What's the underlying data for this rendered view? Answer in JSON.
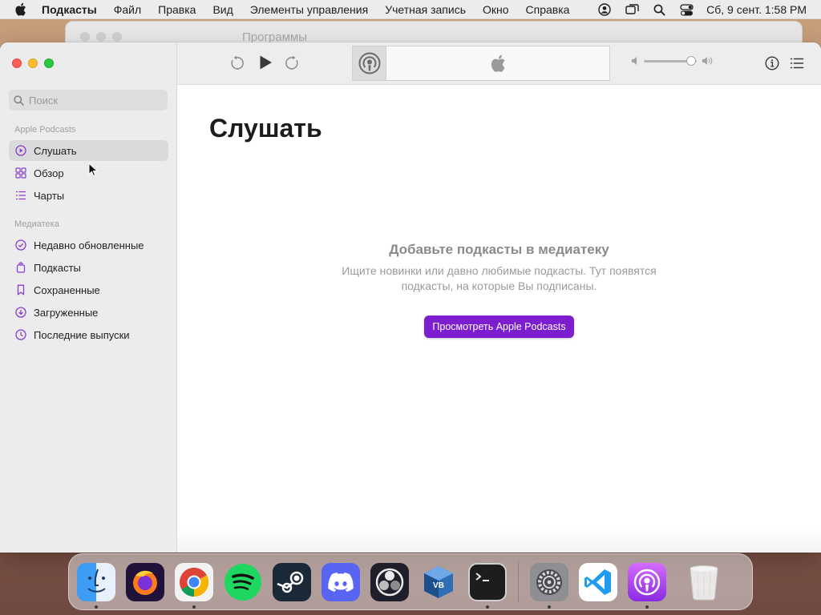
{
  "menubar": {
    "items": [
      "Подкасты",
      "Файл",
      "Правка",
      "Вид",
      "Элементы управления",
      "Учетная запись",
      "Окно",
      "Справка"
    ],
    "clock": "Сб, 9 сент.  1:58 PM"
  },
  "background_window": {
    "title": "Программы"
  },
  "sidebar": {
    "search_placeholder": "Поиск",
    "sections": [
      {
        "title": "Apple Podcasts",
        "items": [
          {
            "label": "Слушать",
            "icon": "play-circle-icon",
            "selected": true
          },
          {
            "label": "Обзор",
            "icon": "grid-icon",
            "selected": false
          },
          {
            "label": "Чарты",
            "icon": "list-icon",
            "selected": false
          }
        ]
      },
      {
        "title": "Медиатека",
        "items": [
          {
            "label": "Недавно обновленные",
            "icon": "check-circle-icon",
            "selected": false
          },
          {
            "label": "Подкасты",
            "icon": "podcast-stack-icon",
            "selected": false
          },
          {
            "label": "Сохраненные",
            "icon": "bookmark-icon",
            "selected": false
          },
          {
            "label": "Загруженные",
            "icon": "download-circle-icon",
            "selected": false
          },
          {
            "label": "Последние выпуски",
            "icon": "clock-icon",
            "selected": false
          }
        ]
      }
    ]
  },
  "toolbar": {
    "volume_level": 0.9
  },
  "main": {
    "title": "Слушать",
    "empty_heading": "Добавьте подкасты в медиатеку",
    "empty_desc_line1": "Ищите новинки или давно любимые подкасты. Тут появятся",
    "empty_desc_line2": "подкасты, на которые Вы подписаны.",
    "browse_button": "Просмотреть Apple Podcasts"
  },
  "dock": {
    "apps": [
      {
        "name": "Finder",
        "icon": "finder-icon",
        "running": true
      },
      {
        "name": "Firefox",
        "icon": "firefox-icon",
        "running": false
      },
      {
        "name": "Google Chrome",
        "icon": "chrome-icon",
        "running": true
      },
      {
        "name": "Spotify",
        "icon": "spotify-icon",
        "running": false
      },
      {
        "name": "Steam",
        "icon": "steam-icon",
        "running": false
      },
      {
        "name": "Discord",
        "icon": "discord-icon",
        "running": false
      },
      {
        "name": "OBS",
        "icon": "obs-icon",
        "running": false
      },
      {
        "name": "VirtualBox",
        "icon": "virtualbox-icon",
        "running": false
      },
      {
        "name": "Terminal",
        "icon": "terminal-icon",
        "running": true
      },
      {
        "name": "System Settings",
        "icon": "settings-icon",
        "running": true
      },
      {
        "name": "Visual Studio Code",
        "icon": "vscode-icon",
        "running": false
      },
      {
        "name": "Podcasts",
        "icon": "podcasts-icon",
        "running": true
      },
      {
        "name": "Trash",
        "icon": "trash-icon",
        "running": false
      }
    ]
  },
  "colors": {
    "accent": "#7c1ed0",
    "nav_icon": "#8a3ccf",
    "selected_bg": "#dadada"
  }
}
